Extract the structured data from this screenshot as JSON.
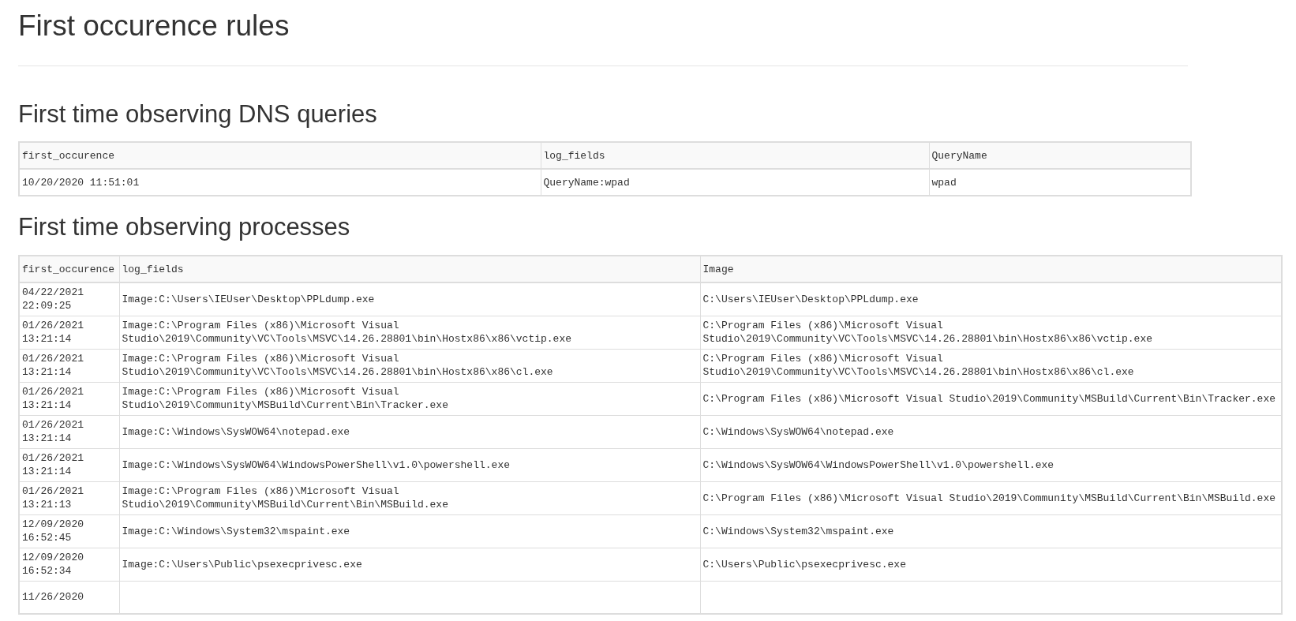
{
  "page_title": "First occurence rules",
  "sections": [
    {
      "heading": "First time observing DNS queries",
      "table": {
        "columns": [
          "first_occurence",
          "log_fields",
          "QueryName"
        ],
        "rows": [
          [
            "10/20/2020 11:51:01",
            "QueryName:wpad",
            "wpad"
          ]
        ]
      }
    },
    {
      "heading": "First time observing processes",
      "table": {
        "columns": [
          "first_occurence",
          "log_fields",
          "Image"
        ],
        "rows": [
          [
            "04/22/2021 22:09:25",
            "Image:C:\\Users\\IEUser\\Desktop\\PPLdump.exe",
            "C:\\Users\\IEUser\\Desktop\\PPLdump.exe"
          ],
          [
            "01/26/2021 13:21:14",
            "Image:C:\\Program Files (x86)\\Microsoft Visual Studio\\2019\\Community\\VC\\Tools\\MSVC\\14.26.28801\\bin\\Hostx86\\x86\\vctip.exe",
            "C:\\Program Files (x86)\\Microsoft Visual Studio\\2019\\Community\\VC\\Tools\\MSVC\\14.26.28801\\bin\\Hostx86\\x86\\vctip.exe"
          ],
          [
            "01/26/2021 13:21:14",
            "Image:C:\\Program Files (x86)\\Microsoft Visual Studio\\2019\\Community\\VC\\Tools\\MSVC\\14.26.28801\\bin\\Hostx86\\x86\\cl.exe",
            "C:\\Program Files (x86)\\Microsoft Visual Studio\\2019\\Community\\VC\\Tools\\MSVC\\14.26.28801\\bin\\Hostx86\\x86\\cl.exe"
          ],
          [
            "01/26/2021 13:21:14",
            "Image:C:\\Program Files (x86)\\Microsoft Visual Studio\\2019\\Community\\MSBuild\\Current\\Bin\\Tracker.exe",
            "C:\\Program Files (x86)\\Microsoft Visual Studio\\2019\\Community\\MSBuild\\Current\\Bin\\Tracker.exe"
          ],
          [
            "01/26/2021 13:21:14",
            "Image:C:\\Windows\\SysWOW64\\notepad.exe",
            "C:\\Windows\\SysWOW64\\notepad.exe"
          ],
          [
            "01/26/2021 13:21:14",
            "Image:C:\\Windows\\SysWOW64\\WindowsPowerShell\\v1.0\\powershell.exe",
            "C:\\Windows\\SysWOW64\\WindowsPowerShell\\v1.0\\powershell.exe"
          ],
          [
            "01/26/2021 13:21:13",
            "Image:C:\\Program Files (x86)\\Microsoft Visual Studio\\2019\\Community\\MSBuild\\Current\\Bin\\MSBuild.exe",
            "C:\\Program Files (x86)\\Microsoft Visual Studio\\2019\\Community\\MSBuild\\Current\\Bin\\MSBuild.exe"
          ],
          [
            "12/09/2020 16:52:45",
            "Image:C:\\Windows\\System32\\mspaint.exe",
            "C:\\Windows\\System32\\mspaint.exe"
          ],
          [
            "12/09/2020 16:52:34",
            "Image:C:\\Users\\Public\\psexecprivesc.exe",
            "C:\\Users\\Public\\psexecprivesc.exe"
          ],
          [
            "11/26/2020"
          ]
        ]
      }
    }
  ]
}
